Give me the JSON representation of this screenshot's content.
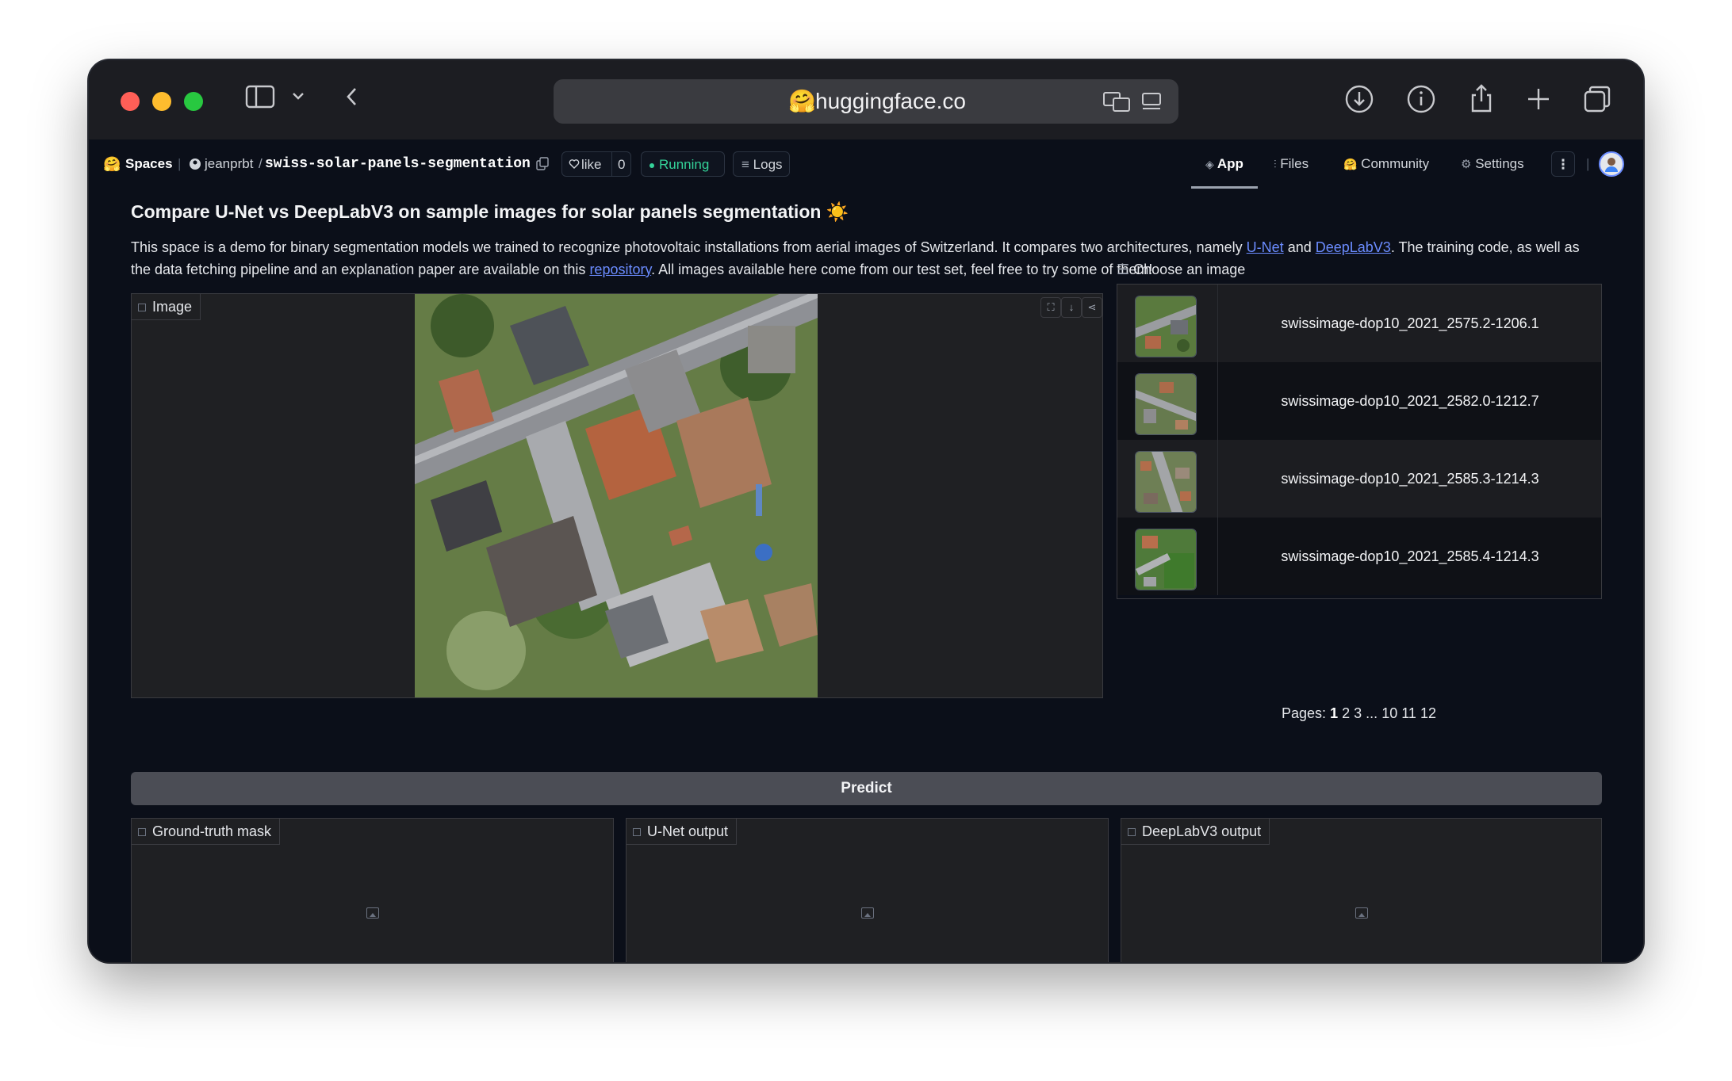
{
  "browser": {
    "url": "huggingface.co",
    "logo_emoji": "🤗",
    "icons": [
      "sidebar-icon",
      "chevron-down-icon",
      "back-icon",
      "translate-icon",
      "reader-icon",
      "download-icon",
      "info-icon",
      "share-icon",
      "plus-icon",
      "tabs-icon"
    ]
  },
  "hf_header": {
    "spaces_label": "Spaces",
    "owner": "jeanprbt",
    "separator": "/",
    "repo": "swiss-solar-panels-segmentation",
    "like_label": "like",
    "like_count": "0",
    "status": "Running",
    "logs_label": "Logs",
    "tabs": [
      {
        "label": "App",
        "active": true
      },
      {
        "label": "Files",
        "active": false
      },
      {
        "label": "Community",
        "active": false
      },
      {
        "label": "Settings",
        "active": false
      }
    ],
    "accent_status": "#34d399"
  },
  "app": {
    "title": "Compare U-Net vs DeepLabV3 on sample images for solar panels segmentation ☀️",
    "desc_part1": "This space is a demo for binary segmentation models we trained to recognize photovoltaic installations from aerial images of Switzerland. It compares two architectures, namely ",
    "link_unet": "U-Net",
    "desc_and": " and ",
    "link_deeplab": "DeepLabV3",
    "desc_part2": ". The training code, as well as the data fetching pipeline and an explanation paper are available on this ",
    "link_repo": "repository",
    "desc_part3": ". All images available here come from our test set, feel free to try some of them!",
    "image_label": "Image",
    "choose_label": "Choose an image",
    "examples": [
      "swissimage-dop10_2021_2575.2-1206.1",
      "swissimage-dop10_2021_2582.0-1212.7",
      "swissimage-dop10_2021_2585.3-1214.3",
      "swissimage-dop10_2021_2585.4-1214.3"
    ],
    "pages_label": "Pages:",
    "pages": [
      "1",
      "2",
      "3",
      "...",
      "10",
      "11",
      "12"
    ],
    "current_page": "1",
    "predict_label": "Predict",
    "outputs": [
      "Ground-truth mask",
      "U-Net output",
      "DeepLabV3 output"
    ]
  }
}
